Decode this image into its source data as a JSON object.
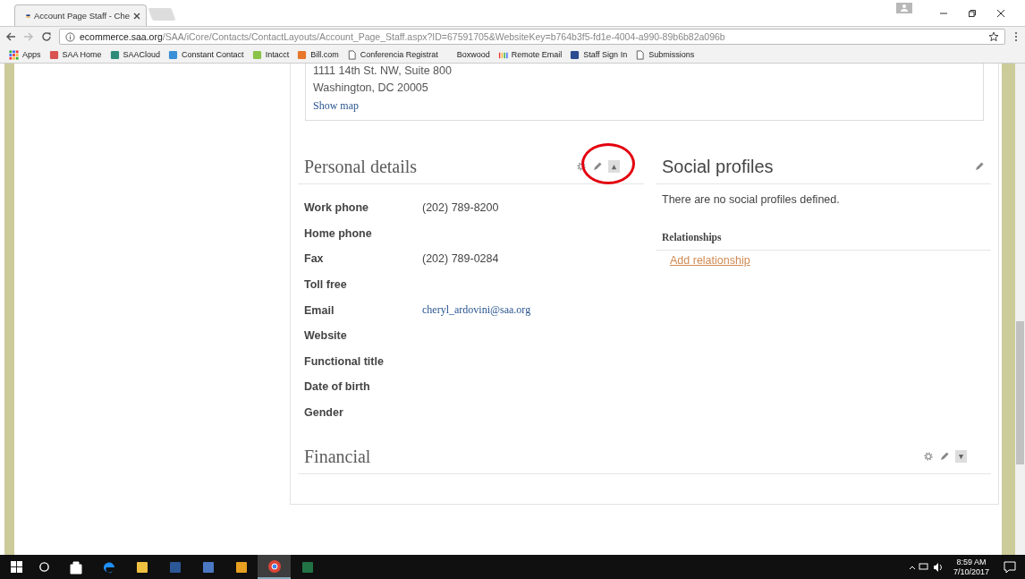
{
  "browser": {
    "tabs": [
      {
        "title": "Account Page Staff - Che",
        "selected": true
      },
      {
        "selected": false
      }
    ],
    "url": {
      "host": "ecommerce.saa.org",
      "path": "/SAA/iCore/Contacts/ContactLayouts/Account_Page_Staff.aspx?ID=67591705&WebsiteKey=b764b3f5-fd1e-4004-a990-89b6b82a096b"
    },
    "bookmarks": [
      {
        "label": "Apps",
        "kind": "grid"
      },
      {
        "label": "SAA Home",
        "kind": "site",
        "color": "#d9534f"
      },
      {
        "label": "SAACloud",
        "kind": "site",
        "color": "#2e8b7a"
      },
      {
        "label": "Constant Contact",
        "kind": "site",
        "color": "#3a8fd6"
      },
      {
        "label": "Intacct",
        "kind": "site",
        "color": "#8bc34a"
      },
      {
        "label": "Bill.com",
        "kind": "site",
        "color": "#e8762b"
      },
      {
        "label": "Conferencia Registrat",
        "kind": "page"
      },
      {
        "label": "Boxwood",
        "kind": "none"
      },
      {
        "label": "Remote Email",
        "kind": "bars"
      },
      {
        "label": "Staff Sign In",
        "kind": "site",
        "color": "#2b4d8f"
      },
      {
        "label": "Submissions",
        "kind": "page"
      }
    ]
  },
  "address": {
    "lines": [
      "1111 14th St. NW, Suite 800",
      "Washington, DC 20005"
    ],
    "link": "Show map"
  },
  "personal_details": {
    "title": "Personal details",
    "expanded": true,
    "fields": [
      {
        "label": "Work phone",
        "value": "(202) 789-8200",
        "kind": "text"
      },
      {
        "label": "Home phone"
      },
      {
        "label": "Fax",
        "value": "(202) 789-0284",
        "kind": "text"
      },
      {
        "label": "Toll free"
      },
      {
        "label": "Email",
        "value": "cheryl_ardovini@saa.org",
        "kind": "link"
      },
      {
        "label": "Website"
      },
      {
        "label": "Functional title"
      },
      {
        "label": "Date of birth"
      },
      {
        "label": "Gender"
      }
    ]
  },
  "social_profiles": {
    "title": "Social profiles",
    "message": "There are no social profiles defined.",
    "relationships_title": "Relationships",
    "add_link": "Add relationship"
  },
  "financial": {
    "title": "Financial",
    "expanded": false
  },
  "taskbar": {
    "apps": [
      {
        "kind": "store",
        "selected": false
      },
      {
        "kind": "edge",
        "selected": false
      },
      {
        "kind": "folder",
        "selected": false
      },
      {
        "kind": "word",
        "selected": false
      },
      {
        "kind": "network",
        "selected": false
      },
      {
        "kind": "outlook",
        "selected": false
      },
      {
        "kind": "chrome",
        "selected": true
      },
      {
        "kind": "excel",
        "selected": false
      }
    ],
    "time": "8:59 AM",
    "date": "7/10/2017"
  }
}
